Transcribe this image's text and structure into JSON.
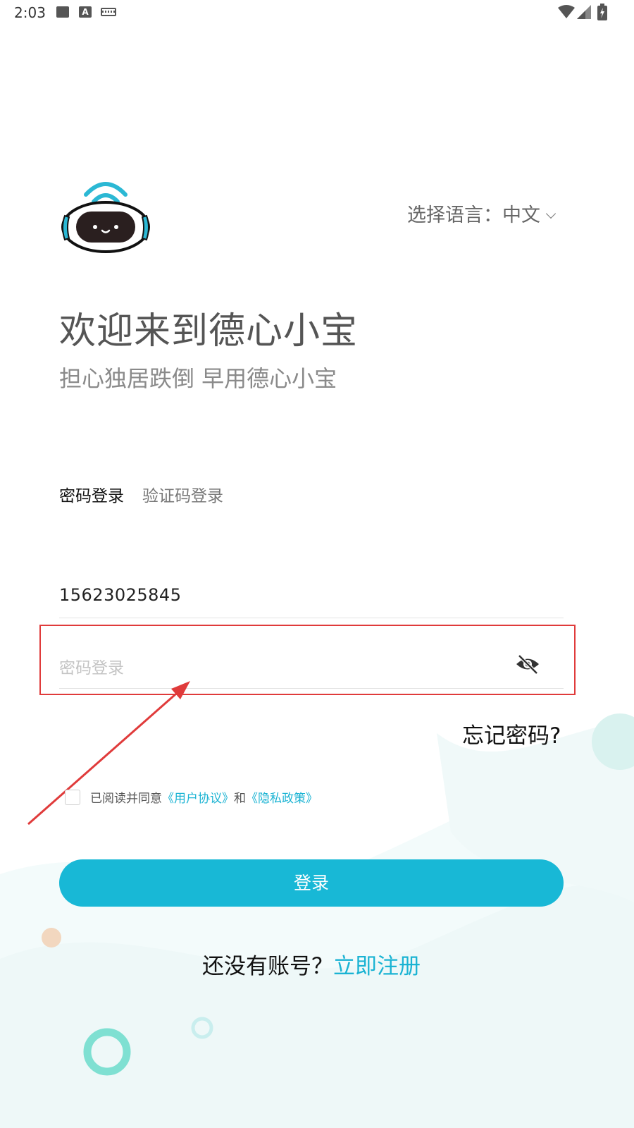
{
  "status_bar": {
    "time": "2:03",
    "letter_icon": "A"
  },
  "language": {
    "label": "选择语言：",
    "value": "中文"
  },
  "header": {
    "title": "欢迎来到德心小宝",
    "subtitle": "担心独居跌倒 早用德心小宝"
  },
  "tabs": [
    {
      "label": "密码登录",
      "active": true
    },
    {
      "label": "验证码登录",
      "active": false
    }
  ],
  "form": {
    "phone_value": "15623025845",
    "password_placeholder": "密码登录",
    "forgot_label": "忘记密码?"
  },
  "agreement": {
    "prefix": "已阅读并同意",
    "user_agreement": "《用户协议》",
    "and": "和",
    "privacy_policy": "《隐私政策》"
  },
  "login_button": "登录",
  "register": {
    "prompt": "还没有账号？",
    "link": "立即注册"
  },
  "colors": {
    "accent": "#18b8d6",
    "annotation": "#e03b3b"
  },
  "icons": {
    "status": [
      "image-icon",
      "font-icon",
      "keyboard-icon",
      "wifi-icon",
      "signal-icon",
      "battery-icon"
    ],
    "password_toggle": "eye-off-icon",
    "language_dropdown": "chevron-down-icon"
  }
}
